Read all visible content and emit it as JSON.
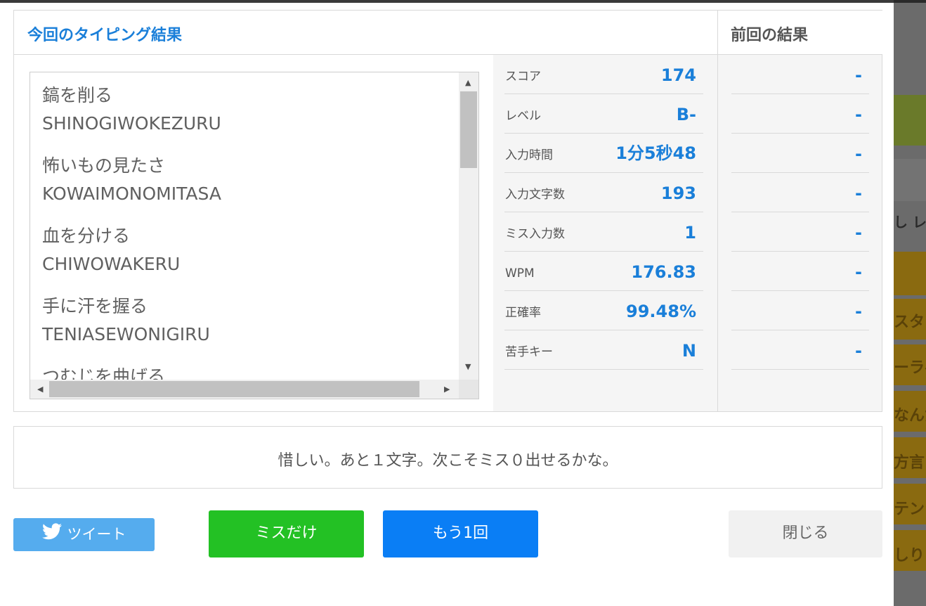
{
  "current": {
    "title": "今回のタイピング結果",
    "words": [
      {
        "jp": "鎬を削る",
        "roma": "SHINOGIWOKEZURU"
      },
      {
        "jp": "怖いもの見たさ",
        "roma": "KOWAIMONOMITASA"
      },
      {
        "jp": "血を分ける",
        "roma": "CHIWOWAKERU"
      },
      {
        "jp": "手に汗を握る",
        "roma": "TENIASEWONIGIRU"
      },
      {
        "jp": "つむじを曲げる",
        "roma": ""
      }
    ],
    "stats": [
      {
        "label": "スコア",
        "value": "174"
      },
      {
        "label": "レベル",
        "value": "B-"
      },
      {
        "label": "入力時間",
        "value": "1分5秒48"
      },
      {
        "label": "入力文字数",
        "value": "193"
      },
      {
        "label": "ミス入力数",
        "value": "1"
      },
      {
        "label": "WPM",
        "value": "176.83"
      },
      {
        "label": "正確率",
        "value": "99.48%"
      },
      {
        "label": "苦手キー",
        "value": "N"
      }
    ]
  },
  "previous": {
    "title": "前回の結果",
    "values": [
      "-",
      "-",
      "-",
      "-",
      "-",
      "-",
      "-",
      "-"
    ]
  },
  "message": "惜しい。あと１文字。次こそミス０出せるかな。",
  "buttons": {
    "tweet": "ツイート",
    "miss_only": "ミスだけ",
    "retry": "もう1回",
    "close": "閉じる"
  },
  "background_fragments": [
    "し レベ",
    "スタシ",
    "ーラベ",
    "なんだ",
    "方言",
    "テンシ",
    "しりと"
  ],
  "colors": {
    "accent_blue": "#1a7fd9",
    "tweet": "#55acee",
    "miss_green": "#23c124",
    "retry_blue": "#0a7ef5",
    "close_gray": "#f1f1f1"
  }
}
